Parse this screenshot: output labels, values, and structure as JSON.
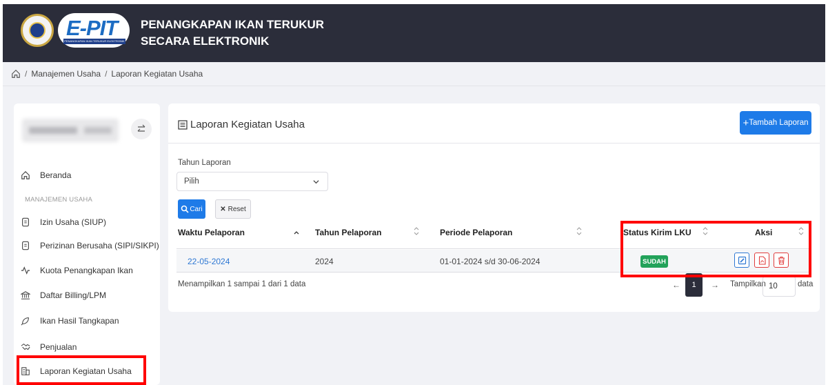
{
  "app": {
    "title_line1": "PENANGKAPAN IKAN TERUKUR",
    "title_line2": "SECARA ELEKTRONIK",
    "logo_text": "E-PIT",
    "logo_subtitle": "PENANGKAPAN IKAN TERUKUR ELEKTRONIK"
  },
  "breadcrumb": {
    "separator": "/",
    "items": [
      "Manajemen Usaha",
      "Laporan Kegiatan Usaha"
    ]
  },
  "sidebar": {
    "section_label": "MANAJEMEN USAHA",
    "items": [
      {
        "label": "Beranda",
        "icon": "home-icon"
      },
      {
        "label": "Izin Usaha (SIUP)",
        "icon": "document-icon"
      },
      {
        "label": "Perizinan Berusaha (SIPI/SIKPI)",
        "icon": "document-icon"
      },
      {
        "label": "Kuota Penangkapan Ikan",
        "icon": "activity-icon"
      },
      {
        "label": "Daftar Billing/LPM",
        "icon": "bank-icon"
      },
      {
        "label": "Ikan Hasil Tangkapan",
        "icon": "fish-icon"
      },
      {
        "label": "Penjualan",
        "icon": "handshake-icon"
      },
      {
        "label": "Laporan Kegiatan Usaha",
        "icon": "building-icon"
      }
    ]
  },
  "card": {
    "title": "Laporan Kegiatan Usaha",
    "add_button": "Tambah Laporan",
    "filter_label": "Tahun Laporan",
    "filter_value": "Pilih",
    "search_button": "Cari",
    "reset_button": "Reset"
  },
  "table": {
    "columns": [
      "Waktu Pelaporan",
      "Tahun Pelaporan",
      "Periode Pelaporan",
      "Status Kirim LKU",
      "Aksi"
    ],
    "rows": [
      {
        "waktu": "22-05-2024",
        "tahun": "2024",
        "periode": "01-01-2024 s/d 30-06-2024",
        "status": "SUDAH"
      }
    ],
    "info": "Menampilkan 1 sampai 1 dari 1 data",
    "prev": "←",
    "page": "1",
    "next": "→",
    "per_page_label": "Tampilkan",
    "per_page_value": "10",
    "per_page_suffix": "data"
  },
  "colors": {
    "topbar": "#2b2d3a",
    "primary": "#1e7be8",
    "success": "#22a25a",
    "highlight": "#ff0000"
  }
}
